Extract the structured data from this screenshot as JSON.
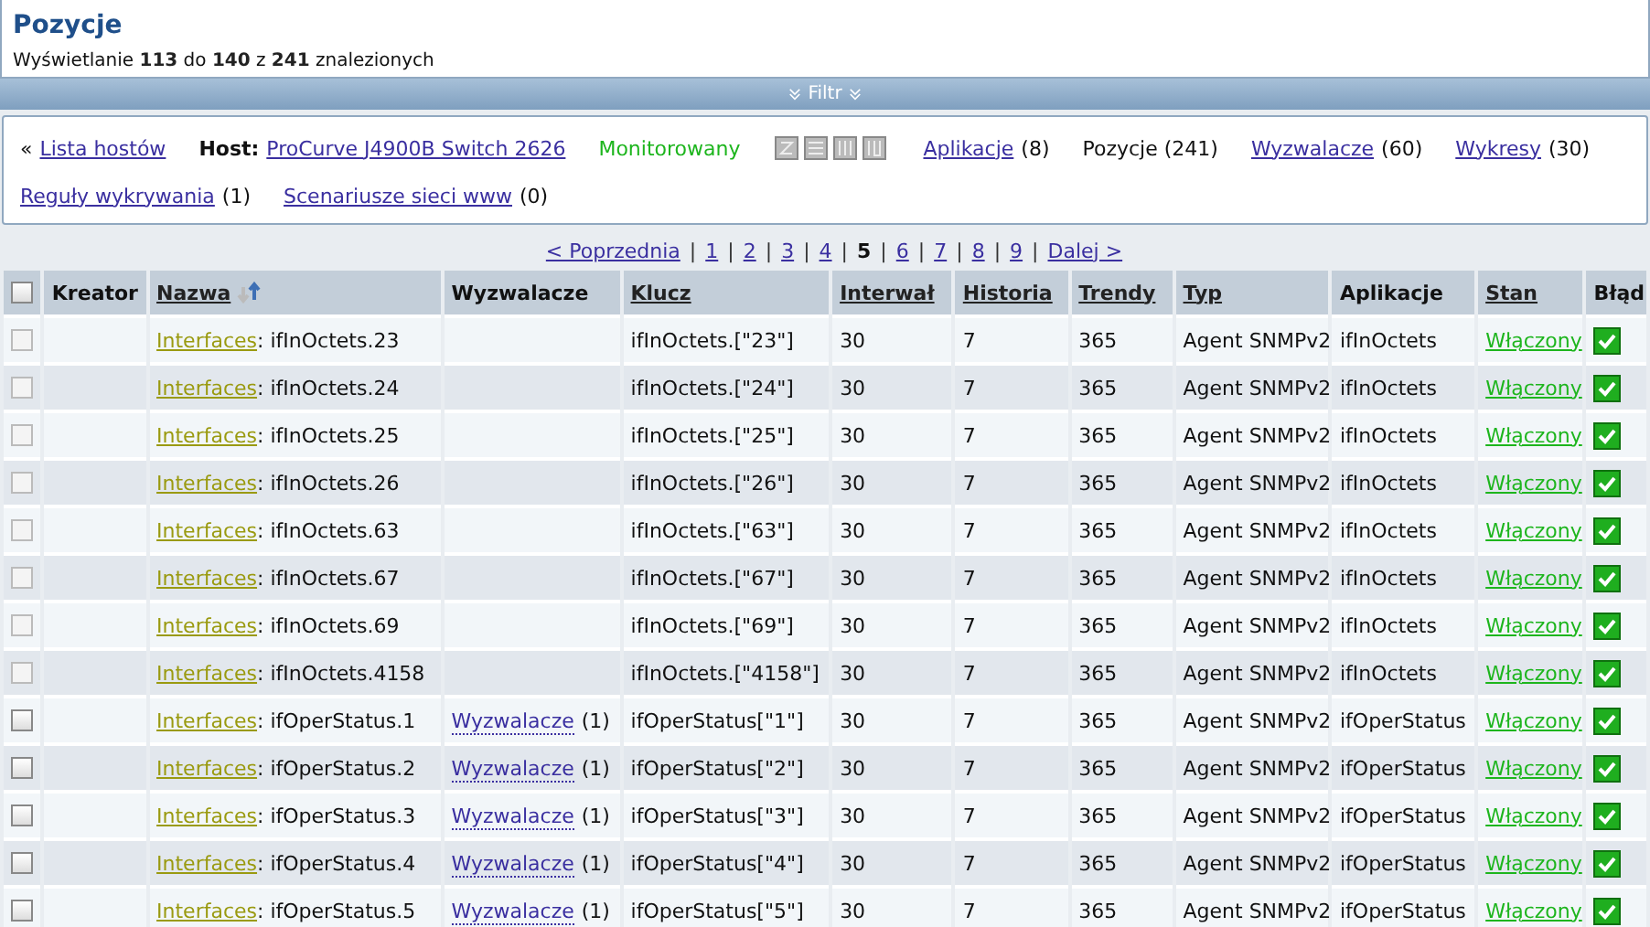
{
  "header": {
    "title": "Pozycje",
    "summary": "Wyświetlanie **113** do **140** z **241** znalezionych"
  },
  "filter_bar": {
    "label": "Filtr",
    "expanded": false
  },
  "host_nav": {
    "back_icon": "«",
    "back_link": "Lista hostów",
    "host_label": "Host:",
    "host_name": "ProCurve J4900B Switch 2626",
    "status": "Monitorowany",
    "availability": [
      {
        "kind": "zbx"
      },
      {
        "kind": "snmp"
      },
      {
        "kind": "jmx"
      },
      {
        "kind": "ipmi"
      }
    ],
    "links": [
      {
        "label": "Aplikacje",
        "count": "(8)",
        "selected": false
      },
      {
        "label": "Pozycje",
        "count": "(241)",
        "selected": true
      },
      {
        "label": "Wyzwalacze",
        "count": "(60)",
        "selected": false
      },
      {
        "label": "Wykresy",
        "count": "(30)",
        "selected": false
      },
      {
        "label": "Reguły wykrywania",
        "count": "(1)",
        "selected": false
      },
      {
        "label": "Scenariusze sieci www",
        "count": "(0)",
        "selected": false
      }
    ]
  },
  "pagination": {
    "items": [
      {
        "kind": "prev",
        "label": "< Poprzednia"
      },
      {
        "kind": "sep",
        "label": "|"
      },
      {
        "kind": "page",
        "label": "1",
        "selected": false
      },
      {
        "kind": "sep",
        "label": "|"
      },
      {
        "kind": "page",
        "label": "2",
        "selected": false
      },
      {
        "kind": "sep",
        "label": "|"
      },
      {
        "kind": "page",
        "label": "3",
        "selected": false
      },
      {
        "kind": "sep",
        "label": "|"
      },
      {
        "kind": "page",
        "label": "4",
        "selected": false
      },
      {
        "kind": "sep",
        "label": "|"
      },
      {
        "kind": "page",
        "label": "5",
        "selected": true
      },
      {
        "kind": "sep",
        "label": "|"
      },
      {
        "kind": "page",
        "label": "6",
        "selected": false
      },
      {
        "kind": "sep",
        "label": "|"
      },
      {
        "kind": "page",
        "label": "7",
        "selected": false
      },
      {
        "kind": "sep",
        "label": "|"
      },
      {
        "kind": "page",
        "label": "8",
        "selected": false
      },
      {
        "kind": "sep",
        "label": "|"
      },
      {
        "kind": "page",
        "label": "9",
        "selected": false
      },
      {
        "kind": "sep",
        "label": "|"
      },
      {
        "kind": "next",
        "label": "Dalej >"
      }
    ]
  },
  "table": {
    "columns": [
      {
        "kind": "check",
        "checked": false
      },
      {
        "kind": "text",
        "label": "Kreator",
        "sortable": false
      },
      {
        "kind": "text",
        "label": "Nazwa",
        "sortable": true,
        "sorted": true
      },
      {
        "kind": "text",
        "label": "Wyzwalacze",
        "sortable": false
      },
      {
        "kind": "text",
        "label": "Klucz",
        "sortable": true
      },
      {
        "kind": "text",
        "label": "Interwał",
        "sortable": true
      },
      {
        "kind": "text",
        "label": "Historia",
        "sortable": true
      },
      {
        "kind": "text",
        "label": "Trendy",
        "sortable": true
      },
      {
        "kind": "text",
        "label": "Typ",
        "sortable": true
      },
      {
        "kind": "text",
        "label": "Aplikacje",
        "sortable": false
      },
      {
        "kind": "text",
        "label": "Stan",
        "sortable": true
      },
      {
        "kind": "text",
        "label": "Błąd",
        "sortable": false
      }
    ],
    "rows": [
      {
        "checkbox_disabled": true,
        "template": "Interfaces",
        "name": ": ifInOctets.23",
        "triggers": null,
        "key": "ifInOctets.[\"23\"]",
        "interval": "30",
        "history": "7",
        "trends": "365",
        "type": "Agent SNMPv2",
        "application": "ifInOctets",
        "status": "Włączony",
        "error": false
      },
      {
        "checkbox_disabled": true,
        "template": "Interfaces",
        "name": ": ifInOctets.24",
        "triggers": null,
        "key": "ifInOctets.[\"24\"]",
        "interval": "30",
        "history": "7",
        "trends": "365",
        "type": "Agent SNMPv2",
        "application": "ifInOctets",
        "status": "Włączony",
        "error": false
      },
      {
        "checkbox_disabled": true,
        "template": "Interfaces",
        "name": ": ifInOctets.25",
        "triggers": null,
        "key": "ifInOctets.[\"25\"]",
        "interval": "30",
        "history": "7",
        "trends": "365",
        "type": "Agent SNMPv2",
        "application": "ifInOctets",
        "status": "Włączony",
        "error": false
      },
      {
        "checkbox_disabled": true,
        "template": "Interfaces",
        "name": ": ifInOctets.26",
        "triggers": null,
        "key": "ifInOctets.[\"26\"]",
        "interval": "30",
        "history": "7",
        "trends": "365",
        "type": "Agent SNMPv2",
        "application": "ifInOctets",
        "status": "Włączony",
        "error": false
      },
      {
        "checkbox_disabled": true,
        "template": "Interfaces",
        "name": ": ifInOctets.63",
        "triggers": null,
        "key": "ifInOctets.[\"63\"]",
        "interval": "30",
        "history": "7",
        "trends": "365",
        "type": "Agent SNMPv2",
        "application": "ifInOctets",
        "status": "Włączony",
        "error": false
      },
      {
        "checkbox_disabled": true,
        "template": "Interfaces",
        "name": ": ifInOctets.67",
        "triggers": null,
        "key": "ifInOctets.[\"67\"]",
        "interval": "30",
        "history": "7",
        "trends": "365",
        "type": "Agent SNMPv2",
        "application": "ifInOctets",
        "status": "Włączony",
        "error": false
      },
      {
        "checkbox_disabled": true,
        "template": "Interfaces",
        "name": ": ifInOctets.69",
        "triggers": null,
        "key": "ifInOctets.[\"69\"]",
        "interval": "30",
        "history": "7",
        "trends": "365",
        "type": "Agent SNMPv2",
        "application": "ifInOctets",
        "status": "Włączony",
        "error": false
      },
      {
        "checkbox_disabled": true,
        "template": "Interfaces",
        "name": ": ifInOctets.4158",
        "triggers": null,
        "key": "ifInOctets.[\"4158\"]",
        "interval": "30",
        "history": "7",
        "trends": "365",
        "type": "Agent SNMPv2",
        "application": "ifInOctets",
        "status": "Włączony",
        "error": false
      },
      {
        "checkbox_disabled": false,
        "template": "Interfaces",
        "name": ": ifOperStatus.1",
        "triggers": {
          "label": "Wyzwalacze",
          "count": "(1)"
        },
        "key": "ifOperStatus[\"1\"]",
        "interval": "30",
        "history": "7",
        "trends": "365",
        "type": "Agent SNMPv2",
        "application": "ifOperStatus",
        "status": "Włączony",
        "error": false
      },
      {
        "checkbox_disabled": false,
        "template": "Interfaces",
        "name": ": ifOperStatus.2",
        "triggers": {
          "label": "Wyzwalacze",
          "count": "(1)"
        },
        "key": "ifOperStatus[\"2\"]",
        "interval": "30",
        "history": "7",
        "trends": "365",
        "type": "Agent SNMPv2",
        "application": "ifOperStatus",
        "status": "Włączony",
        "error": false
      },
      {
        "checkbox_disabled": false,
        "template": "Interfaces",
        "name": ": ifOperStatus.3",
        "triggers": {
          "label": "Wyzwalacze",
          "count": "(1)"
        },
        "key": "ifOperStatus[\"3\"]",
        "interval": "30",
        "history": "7",
        "trends": "365",
        "type": "Agent SNMPv2",
        "application": "ifOperStatus",
        "status": "Włączony",
        "error": false
      },
      {
        "checkbox_disabled": false,
        "template": "Interfaces",
        "name": ": ifOperStatus.4",
        "triggers": {
          "label": "Wyzwalacze",
          "count": "(1)"
        },
        "key": "ifOperStatus[\"4\"]",
        "interval": "30",
        "history": "7",
        "trends": "365",
        "type": "Agent SNMPv2",
        "application": "ifOperStatus",
        "status": "Włączony",
        "error": false
      },
      {
        "checkbox_disabled": false,
        "template": "Interfaces",
        "name": ": ifOperStatus.5",
        "triggers": {
          "label": "Wyzwalacze",
          "count": "(1)"
        },
        "key": "ifOperStatus[\"5\"]",
        "interval": "30",
        "history": "7",
        "trends": "365",
        "type": "Agent SNMPv2",
        "application": "ifOperStatus",
        "status": "Włączony",
        "error": false
      }
    ]
  }
}
